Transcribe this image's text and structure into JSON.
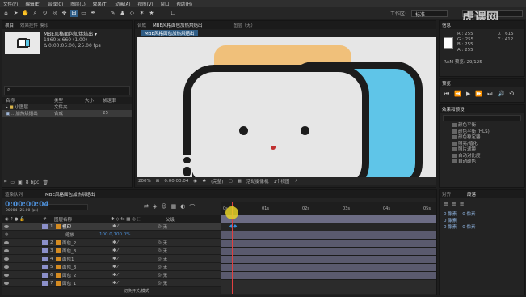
{
  "menu": [
    "文件(F)",
    "编辑(E)",
    "合成(C)",
    "图层(L)",
    "效果(T)",
    "动画(A)",
    "视图(V)",
    "窗口",
    "帮助(H)"
  ],
  "toolbar": {
    "workspace_label": "工作区:",
    "workspace_value": "标准",
    "search_placeholder": "搜索帮助"
  },
  "watermark": "虎课网",
  "project": {
    "tabs": [
      "项目",
      "效果控件 模印"
    ],
    "comp_name": "MBE风格面包加烘焙出 ▾",
    "comp_size": "1860 x 660 (1.00)",
    "comp_duration": "Δ 0:00:05:00, 25.00 fps",
    "headers": [
      "名称",
      "类型",
      "大小",
      "帧速率"
    ],
    "items": [
      {
        "name": "小图层",
        "type": "文件夹",
        "size": "",
        "fps": ""
      },
      {
        "name": "...加热烘焙出",
        "type": "合成",
        "size": "",
        "fps": "25"
      }
    ],
    "bpc": "8 bpc"
  },
  "viewer": {
    "tabs": [
      "合成",
      "MBE风格面包加热烘焙出",
      "图层（无）"
    ],
    "breadcrumb": "MBE风格面包加热烘焙出",
    "zoom": "200%",
    "time": "0:00:00:04",
    "quality": "(完整)",
    "camera": "活动摄像机",
    "views": "1个视图"
  },
  "info": {
    "r": "R : 255",
    "g": "G : 255",
    "b": "B : 255",
    "a": "A : 255",
    "x": "X : 615",
    "y": "Y : 412",
    "ram": "RAM 预览: 29/125"
  },
  "preview": {
    "tab": "预览"
  },
  "effects": {
    "tab": "效果和预设",
    "items": [
      "颜色平衡",
      "颜色平衡 (HLS)",
      "颜色稳定器",
      "照亮/暗化",
      "照片滤镜",
      "自动对比度",
      "自动颜色"
    ]
  },
  "align": {
    "tabs": [
      "对齐",
      "段落"
    ],
    "fields": [
      "0 像素",
      "0 像素",
      "0 像素",
      "0 像素",
      "0 像素"
    ]
  },
  "timeline": {
    "tabs": [
      "渲染队列",
      "MBE风格面包加热烘焙出"
    ],
    "timecode": "0:00:00:04",
    "fps_label": "00004 (25.00 fps)",
    "headers": {
      "num": "#",
      "name": "图层名称",
      "parent": "父级"
    },
    "layers": [
      {
        "num": "1",
        "name": "模印",
        "parent": "无"
      },
      {
        "num": "",
        "name": "缩放",
        "parent": "",
        "value": "100.0,100.0%"
      },
      {
        "num": "2",
        "name": "面包_2",
        "parent": "无"
      },
      {
        "num": "3",
        "name": "面包_3",
        "parent": "无"
      },
      {
        "num": "4",
        "name": "面包1",
        "parent": "无"
      },
      {
        "num": "5",
        "name": "面包_3",
        "parent": "无"
      },
      {
        "num": "6",
        "name": "面包_2",
        "parent": "无"
      },
      {
        "num": "7",
        "name": "面包_1",
        "parent": "无"
      }
    ],
    "ruler": [
      "0s",
      "01s",
      "02s",
      "03s",
      "04s",
      "05s"
    ],
    "footer": "切换开关/模式"
  }
}
